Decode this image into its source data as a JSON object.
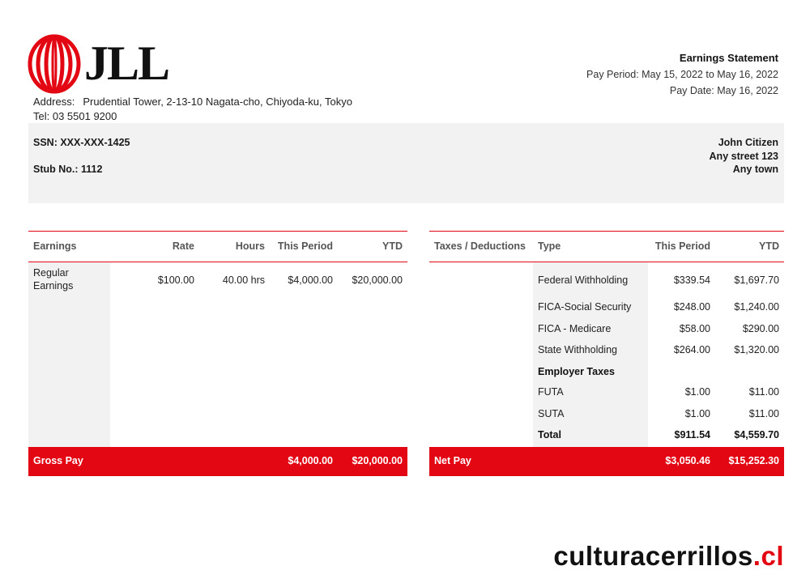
{
  "company": {
    "logo_text": "JLL",
    "address_label": "Address:",
    "address": "Prudential Tower, 2-13-10 Nagata-cho, Chiyoda-ku, Tokyo",
    "tel": "Tel: 03 5501 9200"
  },
  "statement": {
    "title": "Earnings Statement",
    "pay_period": "Pay Period: May 15, 2022 to May 16, 2022",
    "pay_date": "Pay Date: May 16, 2022"
  },
  "employee": {
    "ssn": "SSN: XXX-XXX-1425",
    "stub": "Stub No.: 1112",
    "name": "John Citizen",
    "street": "Any street 123",
    "town": "Any town"
  },
  "earnings": {
    "headers": [
      "Earnings",
      "Rate",
      "Hours",
      "This Period",
      "YTD"
    ],
    "rows": [
      {
        "label_line1": "Regular",
        "label_line2": "Earnings",
        "rate": "$100.00",
        "hours": "40.00 hrs",
        "this_period": "$4,000.00",
        "ytd": "$20,000.00"
      }
    ],
    "total": {
      "label": "Gross Pay",
      "this_period": "$4,000.00",
      "ytd": "$20,000.00"
    }
  },
  "taxes": {
    "headers": [
      "Taxes / Deductions",
      "Type",
      "This Period",
      "YTD"
    ],
    "rows": [
      {
        "type": "Federal Withholding",
        "this_period": "$339.54",
        "ytd": "$1,697.70"
      },
      {
        "type": "FICA-Social Security",
        "this_period": "$248.00",
        "ytd": "$1,240.00"
      },
      {
        "type": "FICA - Medicare",
        "this_period": "$58.00",
        "ytd": "$290.00"
      },
      {
        "type": "State Withholding",
        "this_period": "$264.00",
        "ytd": "$1,320.00"
      },
      {
        "type": "Employer Taxes",
        "this_period": "",
        "ytd": ""
      },
      {
        "type": "FUTA",
        "this_period": "$1.00",
        "ytd": "$11.00"
      },
      {
        "type": "SUTA",
        "this_period": "$1.00",
        "ytd": "$11.00"
      },
      {
        "type": "Total",
        "this_period": "$911.54",
        "ytd": "$4,559.70"
      }
    ],
    "total": {
      "label": "Net Pay",
      "this_period": "$3,050.46",
      "ytd": "$15,252.30"
    }
  },
  "watermark": {
    "text": "culturacerrillos",
    "dot": ".",
    "tld": "cl"
  },
  "colors": {
    "accent": "#e30613",
    "shade": "#f2f2f2"
  }
}
